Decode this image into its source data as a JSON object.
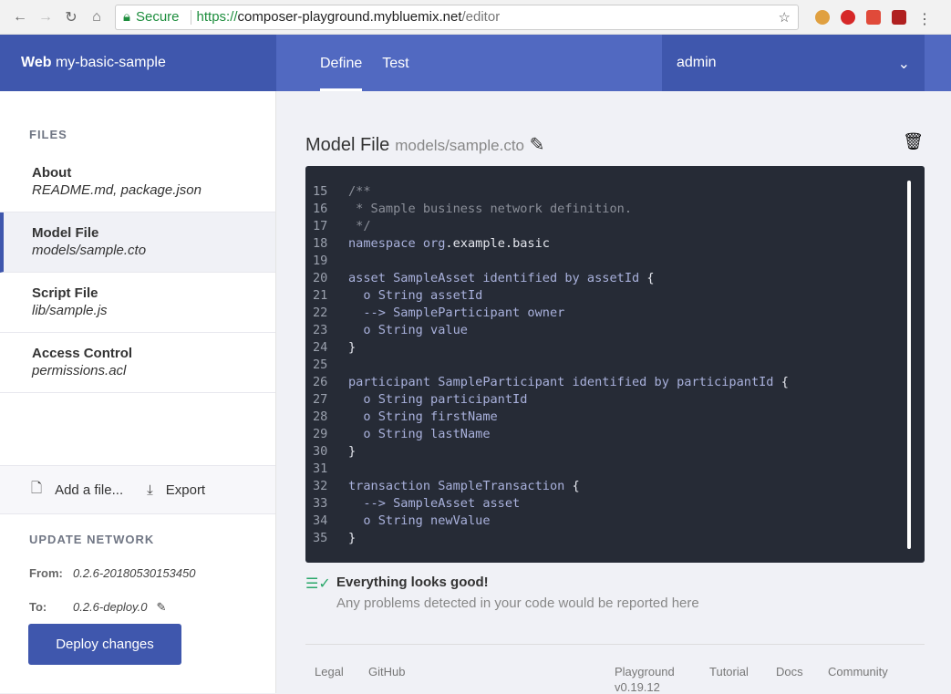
{
  "browser": {
    "secure": "Secure",
    "url_scheme": "https://",
    "url_host": "composer-playground.mybluemix.net",
    "url_path": "/editor"
  },
  "header": {
    "brand_bold": "Web",
    "brand_name": "my-basic-sample",
    "tabs": [
      {
        "label": "Define",
        "active": true
      },
      {
        "label": "Test",
        "active": false
      }
    ],
    "user": "admin"
  },
  "sidebar": {
    "files_heading": "FILES",
    "files": [
      {
        "title": "About",
        "sub": "README.md, package.json"
      },
      {
        "title": "Model File",
        "sub": "models/sample.cto"
      },
      {
        "title": "Script File",
        "sub": "lib/sample.js"
      },
      {
        "title": "Access Control",
        "sub": "permissions.acl"
      }
    ],
    "add_file": "Add a file...",
    "export": "Export",
    "update_heading": "UPDATE NETWORK",
    "from_label": "From:",
    "from_value": "0.2.6-20180530153450",
    "to_label": "To:",
    "to_value": "0.2.6-deploy.0",
    "deploy": "Deploy changes"
  },
  "editor": {
    "title": "Model File",
    "path": "models/sample.cto",
    "lines": [
      {
        "n": "15",
        "segs": [
          [
            "c",
            "/**"
          ]
        ]
      },
      {
        "n": "16",
        "segs": [
          [
            "c",
            " * Sample business network definition."
          ]
        ]
      },
      {
        "n": "17",
        "segs": [
          [
            "c",
            " */"
          ]
        ]
      },
      {
        "n": "18",
        "segs": [
          [
            "k",
            "namespace org"
          ],
          [
            "w",
            ".example.basic"
          ]
        ]
      },
      {
        "n": "19",
        "segs": []
      },
      {
        "n": "20",
        "segs": [
          [
            "k",
            "asset SampleAsset identified by assetId "
          ],
          [
            "w",
            "{"
          ]
        ]
      },
      {
        "n": "21",
        "segs": [
          [
            "k",
            "  o String assetId"
          ]
        ]
      },
      {
        "n": "22",
        "segs": [
          [
            "k",
            "  --> SampleParticipant owner"
          ]
        ]
      },
      {
        "n": "23",
        "segs": [
          [
            "k",
            "  o String value"
          ]
        ]
      },
      {
        "n": "24",
        "segs": [
          [
            "w",
            "}"
          ]
        ]
      },
      {
        "n": "25",
        "segs": []
      },
      {
        "n": "26",
        "segs": [
          [
            "k",
            "participant SampleParticipant identified by participantId "
          ],
          [
            "w",
            "{"
          ]
        ]
      },
      {
        "n": "27",
        "segs": [
          [
            "k",
            "  o String participantId"
          ]
        ]
      },
      {
        "n": "28",
        "segs": [
          [
            "k",
            "  o String firstName"
          ]
        ]
      },
      {
        "n": "29",
        "segs": [
          [
            "k",
            "  o String lastName"
          ]
        ]
      },
      {
        "n": "30",
        "segs": [
          [
            "w",
            "}"
          ]
        ]
      },
      {
        "n": "31",
        "segs": []
      },
      {
        "n": "32",
        "segs": [
          [
            "k",
            "transaction SampleTransaction "
          ],
          [
            "w",
            "{"
          ]
        ]
      },
      {
        "n": "33",
        "segs": [
          [
            "k",
            "  --> SampleAsset asset"
          ]
        ]
      },
      {
        "n": "34",
        "segs": [
          [
            "k",
            "  o String newValue"
          ]
        ]
      },
      {
        "n": "35",
        "segs": [
          [
            "w",
            "}"
          ]
        ]
      }
    ]
  },
  "status": {
    "title": "Everything looks good!",
    "message": "Any problems detected in your code would be reported here"
  },
  "footer": {
    "legal": "Legal",
    "github": "GitHub",
    "playground": "Playground",
    "version": "v0.19.12",
    "tutorial": "Tutorial",
    "docs": "Docs",
    "community": "Community"
  }
}
